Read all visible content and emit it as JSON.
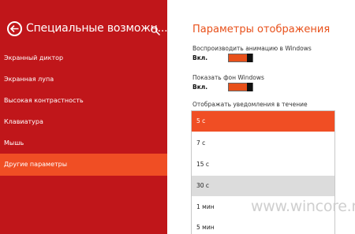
{
  "left_panel": {
    "title": "Специальные возможн...",
    "back_icon": "arrow-left-icon",
    "search_icon": "search-icon",
    "accent": "#c0161a",
    "active_color": "#f04e24",
    "items": [
      {
        "label": "Экранный диктор"
      },
      {
        "label": "Экранная лупа"
      },
      {
        "label": "Высокая контрастность"
      },
      {
        "label": "Клавиатура"
      },
      {
        "label": "Мышь"
      },
      {
        "label": "Другие параметры",
        "active": true
      }
    ]
  },
  "right_panel": {
    "title": "Параметры отображения",
    "title_color": "#e8501a",
    "animation": {
      "label": "Воспроизводить анимацию в Windows",
      "state": "Вкл."
    },
    "background": {
      "label": "Показать фон Windows",
      "state": "Вкл."
    },
    "notifications": {
      "label": "Отображать уведомления в течение",
      "options": [
        "5 с",
        "7 с",
        "15 с",
        "30 с",
        "1 мин",
        "5 мин"
      ],
      "selected": "5 с",
      "hovered": "30 с"
    }
  },
  "watermark": "www.wincore.ru"
}
